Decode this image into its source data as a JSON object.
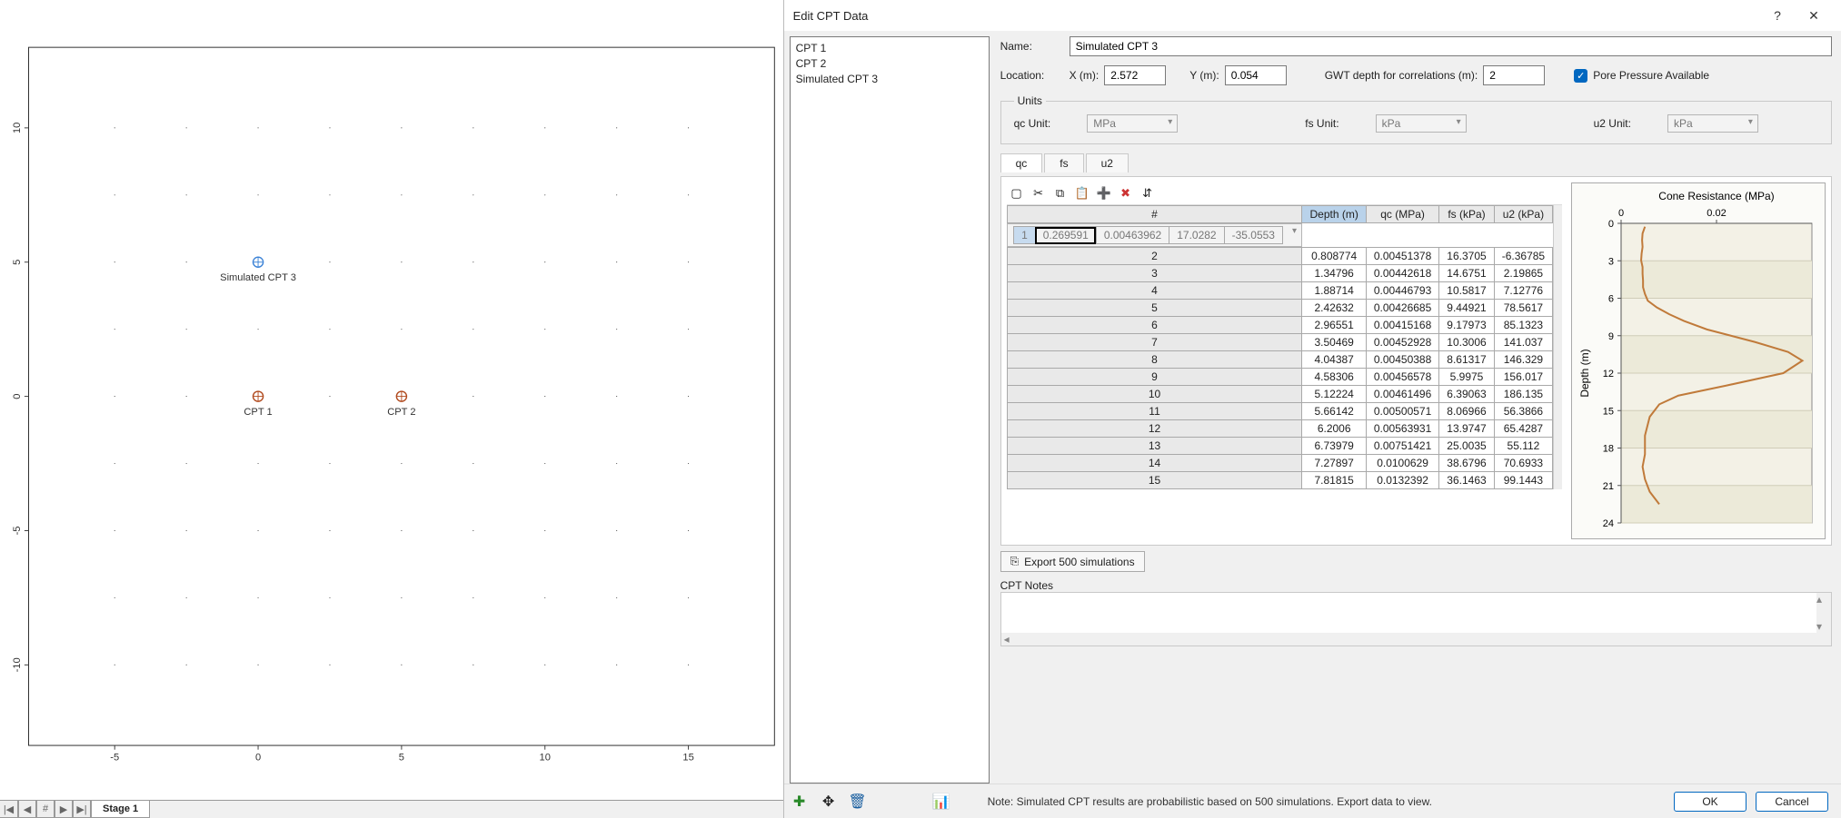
{
  "dialog": {
    "title": "Edit CPT Data",
    "cpt_list": [
      "CPT 1",
      "CPT 2",
      "Simulated CPT 3"
    ],
    "name_label": "Name:",
    "name_value": "Simulated CPT 3",
    "loc_label": "Location:",
    "x_label": "X (m):",
    "x_value": "2.572",
    "y_label": "Y (m):",
    "y_value": "0.054",
    "gwt_label": "GWT depth for correlations (m):",
    "gwt_value": "2",
    "pore_label": "Pore Pressure Available",
    "units": {
      "legend": "Units",
      "qc_lbl": "qc Unit:",
      "qc_val": "MPa",
      "fs_lbl": "fs Unit:",
      "fs_val": "kPa",
      "u2_lbl": "u2 Unit:",
      "u2_val": "kPa"
    },
    "tabs": [
      "qc",
      "fs",
      "u2"
    ],
    "grid": {
      "headers": [
        "#",
        "Depth (m)",
        "qc (MPa)",
        "fs (kPa)",
        "u2 (kPa)"
      ],
      "rows": [
        [
          1,
          "0.269591",
          "0.00463962",
          "17.0282",
          "-35.0553"
        ],
        [
          2,
          "0.808774",
          "0.00451378",
          "16.3705",
          "-6.36785"
        ],
        [
          3,
          "1.34796",
          "0.00442618",
          "14.6751",
          "2.19865"
        ],
        [
          4,
          "1.88714",
          "0.00446793",
          "10.5817",
          "7.12776"
        ],
        [
          5,
          "2.42632",
          "0.00426685",
          "9.44921",
          "78.5617"
        ],
        [
          6,
          "2.96551",
          "0.00415168",
          "9.17973",
          "85.1323"
        ],
        [
          7,
          "3.50469",
          "0.00452928",
          "10.3006",
          "141.037"
        ],
        [
          8,
          "4.04387",
          "0.00450388",
          "8.61317",
          "146.329"
        ],
        [
          9,
          "4.58306",
          "0.00456578",
          "5.9975",
          "156.017"
        ],
        [
          10,
          "5.12224",
          "0.00461496",
          "6.39063",
          "186.135"
        ],
        [
          11,
          "5.66142",
          "0.00500571",
          "8.06966",
          "56.3866"
        ],
        [
          12,
          "6.2006",
          "0.00563931",
          "13.9747",
          "65.4287"
        ],
        [
          13,
          "6.73979",
          "0.00751421",
          "25.0035",
          "55.112"
        ],
        [
          14,
          "7.27897",
          "0.0100629",
          "38.6796",
          "70.6933"
        ],
        [
          15,
          "7.81815",
          "0.0132392",
          "36.1463",
          "99.1443"
        ]
      ]
    },
    "export_label": "Export 500 simulations",
    "notes_label": "CPT Notes",
    "footnote": "Note: Simulated CPT results are probabilistic based on 500 simulations.  Export data to view.",
    "ok": "OK",
    "cancel": "Cancel"
  },
  "plan": {
    "x_ticks": [
      -5,
      0,
      5,
      10,
      15
    ],
    "y_ticks": [
      -10,
      -5,
      0,
      5,
      10
    ],
    "points": [
      {
        "name": "CPT 1",
        "x": 0,
        "y": 0,
        "color": "#b14a1e",
        "label": "CPT 1"
      },
      {
        "name": "CPT 2",
        "x": 5,
        "y": 0,
        "color": "#b14a1e",
        "label": "CPT 2"
      },
      {
        "name": "Simulated CPT 3",
        "x": 0,
        "y": 5,
        "color": "#3b82d6",
        "label": "Simulated CPT 3"
      }
    ],
    "stage_tab": "Stage 1"
  },
  "chart_data": {
    "type": "line",
    "title": "Cone Resistance (MPa)",
    "xlabel": "",
    "ylabel": "Depth (m)",
    "x_ticks": [
      0,
      0.02
    ],
    "y_ticks": [
      0,
      3,
      6,
      9,
      12,
      15,
      18,
      21,
      24
    ],
    "ylim": [
      0,
      24
    ],
    "xlim": [
      0,
      0.04
    ],
    "series": [
      {
        "name": "qc",
        "x": [
          0.005,
          0.0045,
          0.0044,
          0.0045,
          0.0043,
          0.0042,
          0.0045,
          0.0045,
          0.0046,
          0.0046,
          0.005,
          0.0056,
          0.0075,
          0.0101,
          0.0132,
          0.018,
          0.028,
          0.035,
          0.038,
          0.034,
          0.022,
          0.012,
          0.008,
          0.006,
          0.005,
          0.005,
          0.0045,
          0.005,
          0.006,
          0.007,
          0.008
        ],
        "y": [
          0.27,
          0.81,
          1.35,
          1.89,
          2.43,
          2.97,
          3.5,
          4.04,
          4.58,
          5.12,
          5.66,
          6.2,
          6.74,
          7.28,
          7.82,
          8.5,
          9.5,
          10.3,
          11.0,
          12.0,
          13.0,
          13.8,
          14.5,
          15.5,
          17.0,
          18.5,
          19.5,
          20.5,
          21.5,
          22.0,
          22.5
        ]
      }
    ]
  }
}
